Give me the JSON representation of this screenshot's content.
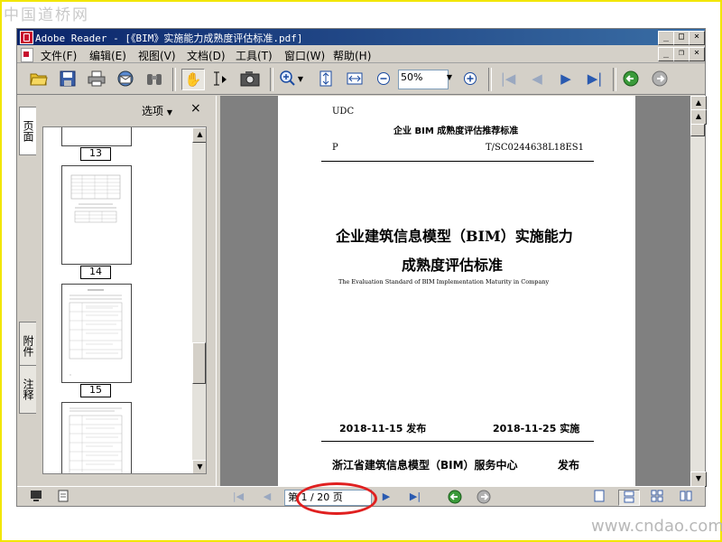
{
  "watermark_top": "中国道桥网",
  "watermark_bottom": "www.cndao.com",
  "window": {
    "title": "Adobe Reader - [《BIM》实施能力成熟度评估标准.pdf]"
  },
  "menu": [
    "文件(F)",
    "编辑(E)",
    "视图(V)",
    "文档(D)",
    "工具(T)",
    "窗口(W)",
    "帮助(H)"
  ],
  "toolbar": {
    "zoom_value": "50%"
  },
  "side_tabs": [
    "页面",
    "附件",
    "注释"
  ],
  "nav_panel": {
    "options_label": "选项",
    "close_label": "×",
    "page_labels": [
      "13",
      "14",
      "15"
    ]
  },
  "document": {
    "udc": "UDC",
    "series_title": "企业 BIM 成熟度评估推荐标准",
    "code_left": "P",
    "code_right": "T/SC0244638L18ES1",
    "title_line1": "企业建筑信息模型（BIM）实施能力",
    "title_line2": "成熟度评估标准",
    "english_title": "The Evaluation Standard of BIM Implementation Maturity in Company",
    "release_date": "2018-11-15 发布",
    "effective_date": "2018-11-25 实施",
    "publisher": "浙江省建筑信息模型（BIM）服务中心",
    "publish_word": "发布"
  },
  "status": {
    "page_indicator": "第 1 / 20 页"
  },
  "colors": {
    "titlebar_start": "#0a246a",
    "titlebar_end": "#3a6ea5",
    "highlight_ring": "#e02020",
    "frame_border": "#f2e600"
  }
}
